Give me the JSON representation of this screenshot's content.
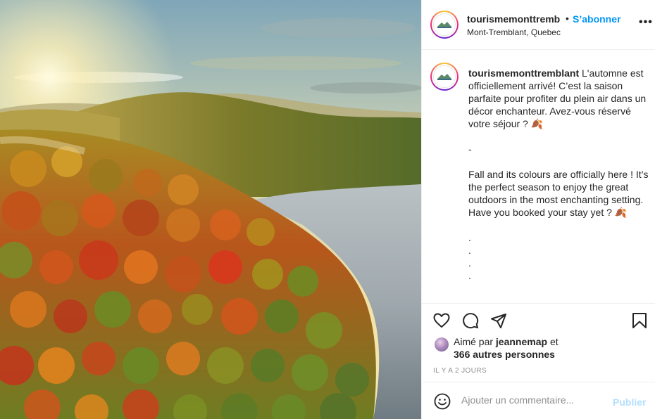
{
  "post": {
    "image_alt": "Aerial view of autumn forest and lake"
  },
  "header": {
    "username": "tourismemonttremb",
    "separator": "•",
    "follow_label": "S’abonner",
    "location": "Mont-Tremblant, Quebec",
    "more_icon": "more-options-icon",
    "more_label": "•••"
  },
  "caption": {
    "username": "tourismemonttremblant",
    "text": " L'automne est officiellement arrivé! C’est la saison parfaite pour profiter du plein air dans un décor enchanteur. Avez-vous réservé votre séjour ? 🍂\n\n-\n\nFall and its colours are officially here ! It’s the perfect season to enjoy the great outdoors in the most enchanting setting. Have you booked your stay yet ? 🍂\n\n.\n.\n.\n."
  },
  "actions": {
    "icons": [
      "heart-icon",
      "comment-icon",
      "share-icon",
      "bookmark-icon"
    ]
  },
  "likes": {
    "prefix": "Aimé par ",
    "user": "jeannemap",
    "suffix": " et",
    "others": "366 autres personnes"
  },
  "timestamp": "IL Y A 2 JOURS",
  "comment": {
    "placeholder": "Ajouter un commentaire...",
    "publish_label": "Publier",
    "emoji_icon": "emoji-icon"
  },
  "colors": {
    "accent": "#0095f6",
    "publish_disabled": "#b2dffc",
    "text": "#262626",
    "muted": "#8e8e8e",
    "border": "#efefef"
  }
}
